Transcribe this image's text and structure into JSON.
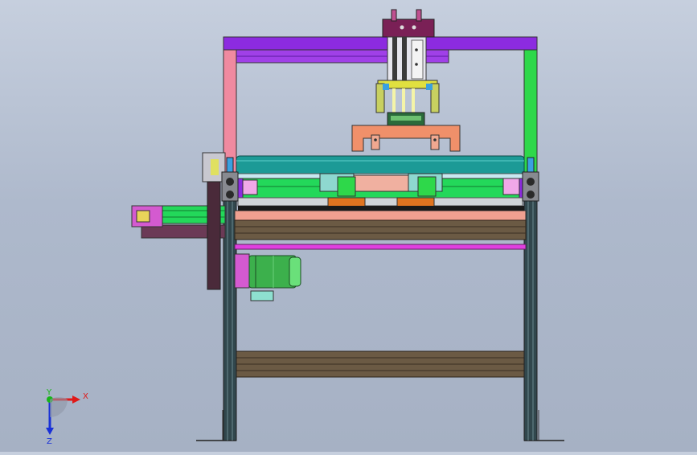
{
  "view": {
    "background_top": "#c6cfde",
    "background_bottom": "#a6b1c4"
  },
  "triad": {
    "x_label": "X",
    "y_label": "Y",
    "z_label": "Z",
    "x_color": "#e01818",
    "y_color": "#18b418",
    "z_color": "#1830d8"
  },
  "colors": {
    "frame_left": "#f08aa0",
    "frame_right": "#2ed84a",
    "frame_top": "#8c2be0",
    "leg_dark": "#31474d",
    "roller": "#1c9a96",
    "rail_green": "#23d85a",
    "slab_brown": "#6b5a44",
    "bracket_salmon": "#f0906a",
    "block_orange": "#e07420",
    "motor_green": "#3cb04c",
    "cyl_head": "#7a2056",
    "magenta_bar": "#e040e0"
  }
}
